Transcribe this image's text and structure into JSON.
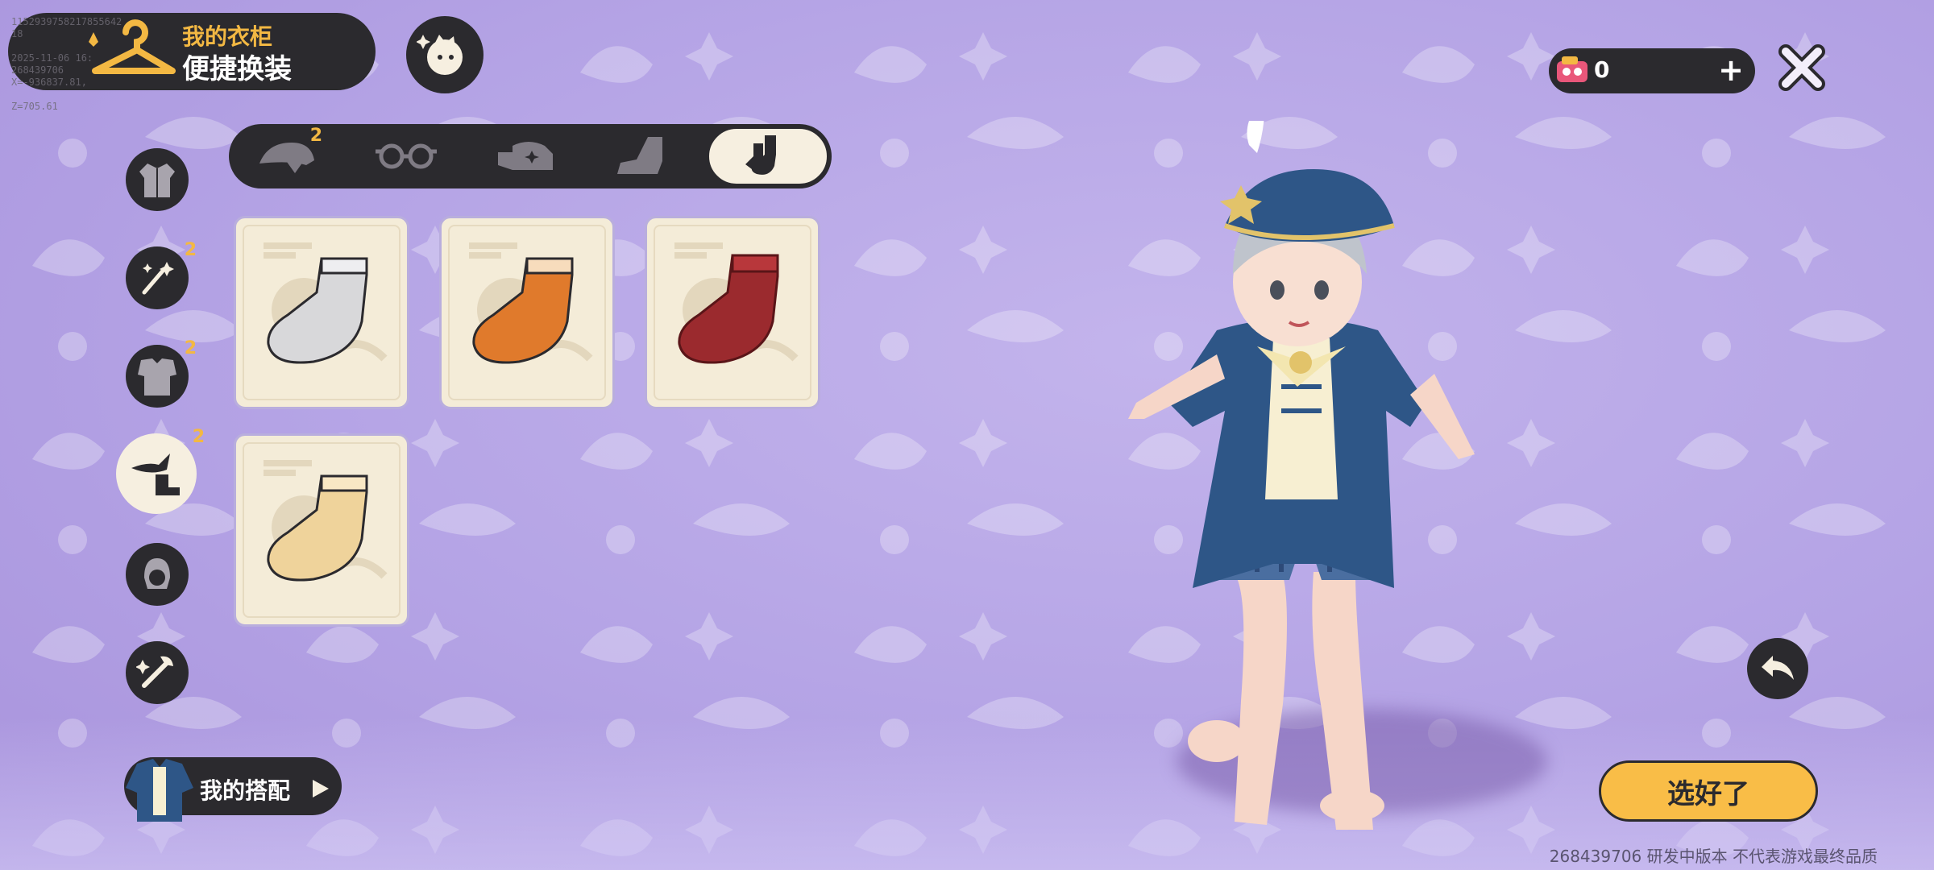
{
  "header": {
    "title_sub": "我的衣柜",
    "title_main": "便捷换装",
    "debug_text": "1152939758217855642\n18\n\n2025-11-06 16:\n268439706\nX=-936837.81,\n\nZ=705.61"
  },
  "sidebar": {
    "categories": [
      {
        "name": "coat",
        "badge": ""
      },
      {
        "name": "magic",
        "badge": "2"
      },
      {
        "name": "outfit",
        "badge": "2"
      },
      {
        "name": "accessories",
        "badge": "2",
        "active": true
      },
      {
        "name": "hair",
        "badge": ""
      },
      {
        "name": "tools",
        "badge": ""
      }
    ]
  },
  "subtabs": [
    {
      "name": "hat",
      "badge": "2"
    },
    {
      "name": "glasses",
      "badge": ""
    },
    {
      "name": "gloves",
      "badge": ""
    },
    {
      "name": "shoes",
      "badge": ""
    },
    {
      "name": "socks",
      "badge": "",
      "active": true
    }
  ],
  "items": [
    {
      "name": "white-sock",
      "color": "#d8d8da"
    },
    {
      "name": "orange-sock",
      "color": "#e07a2c"
    },
    {
      "name": "red-sock",
      "color": "#9b2a2e"
    },
    {
      "name": "cream-sock",
      "color": "#efd39b"
    }
  ],
  "currency": {
    "value": "0",
    "plus": "+"
  },
  "my_outfit": {
    "label": "我的搭配"
  },
  "confirm": {
    "label": "选好了"
  },
  "footer": {
    "text": "268439706  研发中版本 不代表游戏最终品质"
  },
  "colors": {
    "panel": "#2b2a2e",
    "accent": "#f9bd47",
    "card": "#f4ecd8",
    "background": "#b4a3e5"
  }
}
